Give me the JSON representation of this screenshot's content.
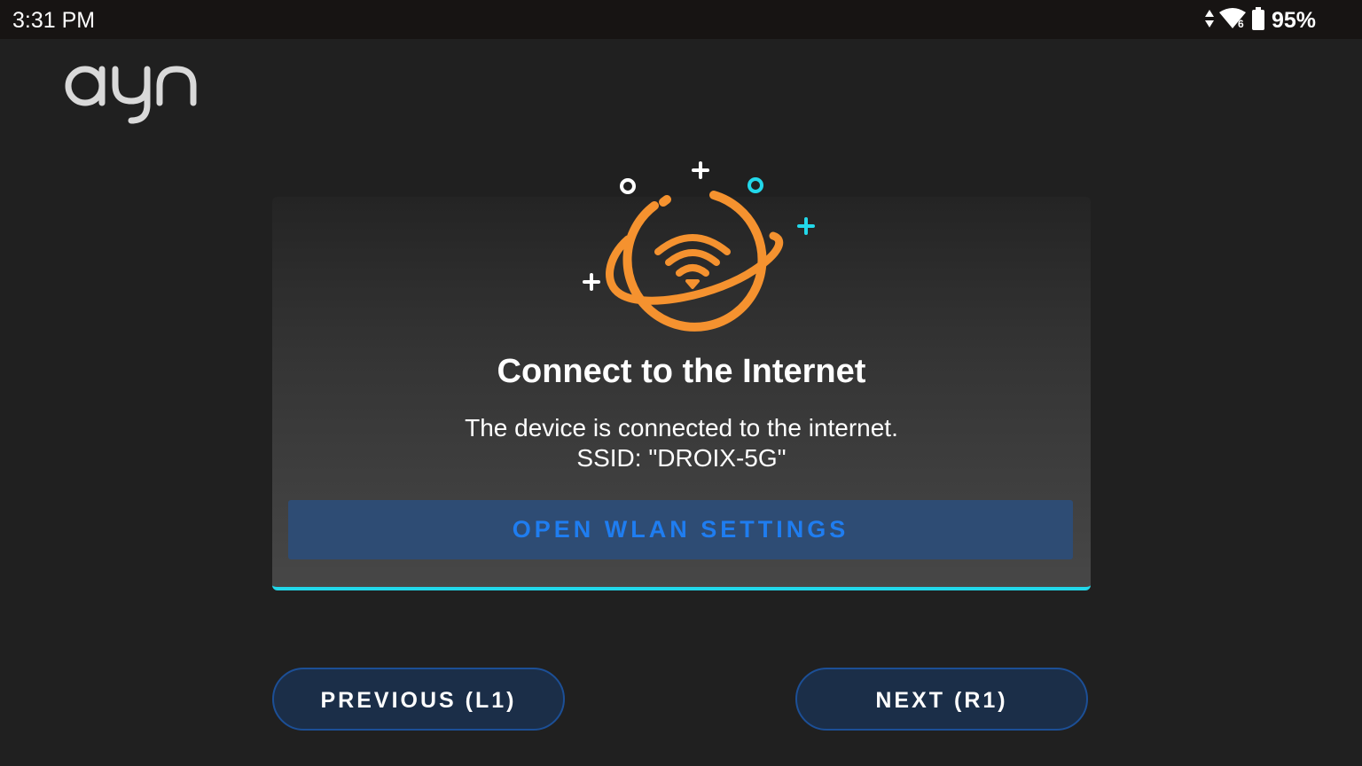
{
  "status_bar": {
    "time": "3:31 PM",
    "battery_percent": "95%",
    "icons": [
      "data-arrows-icon",
      "wifi-6-icon",
      "battery-icon"
    ]
  },
  "brand": {
    "logo_text": "ayn",
    "logo_color": "#d9d9d9"
  },
  "card": {
    "illustration_icon": "wifi-planet-icon",
    "title": "Connect to the Internet",
    "description_line1": "The device is connected to the internet.",
    "description_line2": "SSID: \"DROIX-5G\"",
    "wlan_button_label": "OPEN WLAN SETTINGS",
    "accent_color": "#22d8ea",
    "illustration_color": "#f5922f"
  },
  "navigation": {
    "previous_label": "PREVIOUS (L1)",
    "next_label": "NEXT (R1)",
    "button_border_color": "#1c4f96"
  }
}
